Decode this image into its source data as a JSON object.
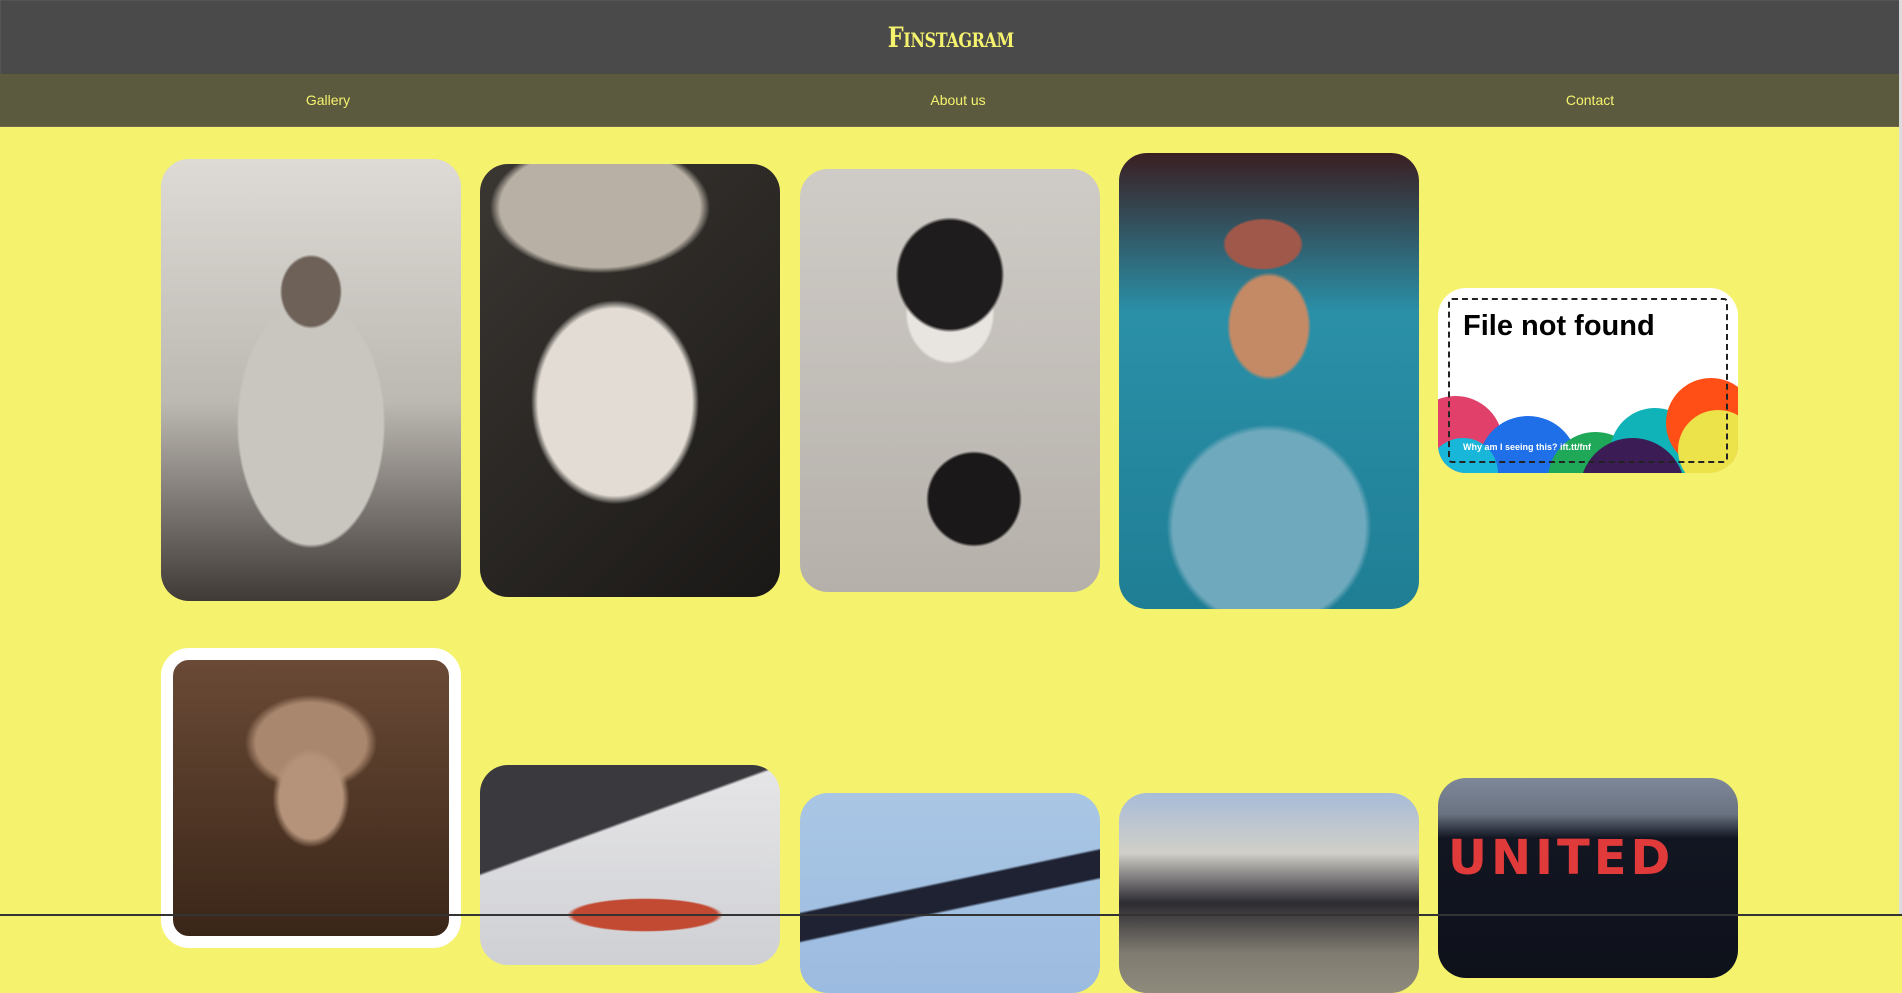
{
  "header": {
    "brand": "Finstagram"
  },
  "nav": {
    "items": [
      "Gallery",
      "About us",
      "Contact"
    ]
  },
  "gallery": {
    "broken_image": {
      "title": "File not found",
      "note": "Why am I seeing this? ift.tt/fnf"
    },
    "overlay_text": "UNITED"
  },
  "colors": {
    "background": "#f5f26e",
    "header": "#4a4a4a",
    "nav": "#5b5a3e",
    "accent_text": "#f5f26e"
  }
}
